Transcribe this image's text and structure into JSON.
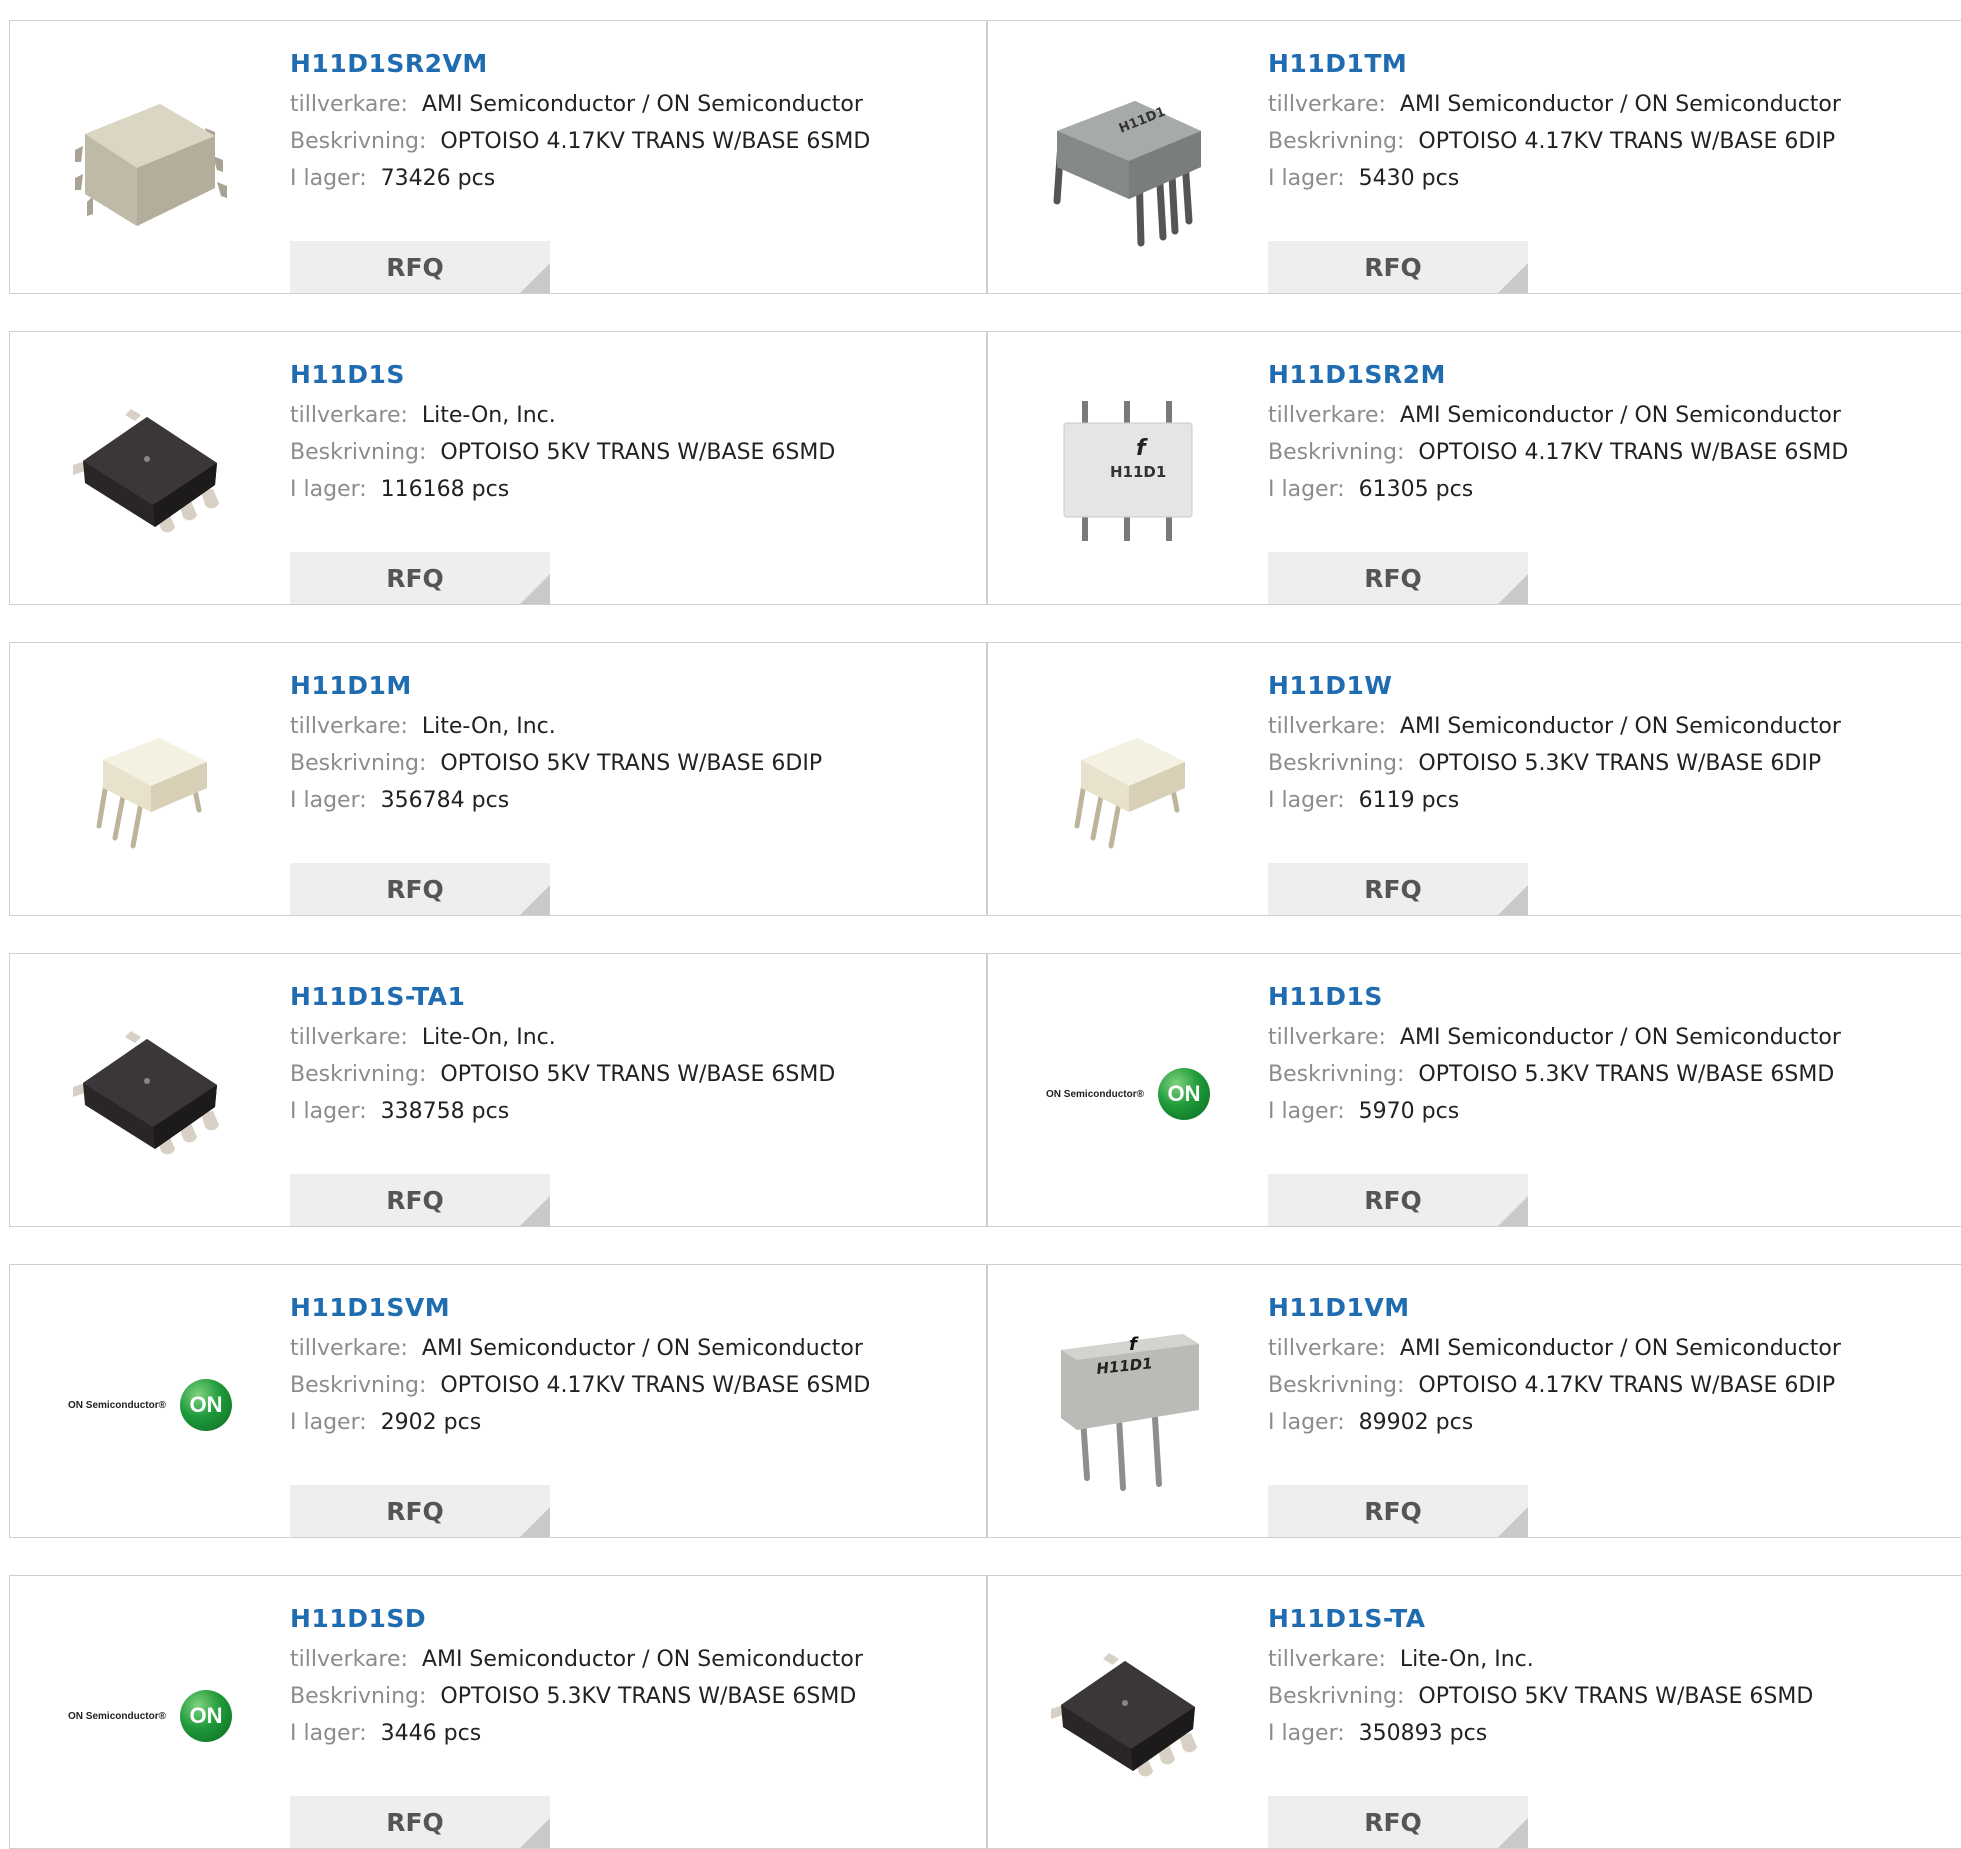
{
  "labels": {
    "manufacturer": "tillverkare:",
    "description": "Beskrivning:",
    "stock": "I lager:",
    "rfq": "RFQ"
  },
  "products": [
    {
      "name": "H11D1SR2VM",
      "manufacturer": "AMI Semiconductor / ON Semiconductor",
      "description": "OPTOISO 4.17KV TRANS W/BASE 6SMD",
      "stock": "73426 pcs",
      "image": "gray-smd-chip-icon"
    },
    {
      "name": "H11D1TM",
      "manufacturer": "AMI Semiconductor / ON Semiconductor",
      "description": "OPTOISO 4.17KV TRANS W/BASE 6DIP",
      "stock": "5430 pcs",
      "image": "gray-dip-chip-icon"
    },
    {
      "name": "H11D1S",
      "manufacturer": "Lite-On, Inc.",
      "description": "OPTOISO 5KV TRANS W/BASE 6SMD",
      "stock": "116168 pcs",
      "image": "black-smd-chip-icon"
    },
    {
      "name": "H11D1SR2M",
      "manufacturer": "AMI Semiconductor / ON Semiconductor",
      "description": "OPTOISO 4.17KV TRANS W/BASE 6SMD",
      "stock": "61305 pcs",
      "image": "white-chip-topview-icon",
      "chip_marking": "H11D1"
    },
    {
      "name": "H11D1M",
      "manufacturer": "Lite-On, Inc.",
      "description": "OPTOISO 5KV TRANS W/BASE 6DIP",
      "stock": "356784 pcs",
      "image": "cream-dip-chip-icon"
    },
    {
      "name": "H11D1W",
      "manufacturer": "AMI Semiconductor / ON Semiconductor",
      "description": "OPTOISO 5.3KV TRANS W/BASE 6DIP",
      "stock": "6119 pcs",
      "image": "cream-dip-chip-icon"
    },
    {
      "name": "H11D1S-TA1",
      "manufacturer": "Lite-On, Inc.",
      "description": "OPTOISO 5KV TRANS W/BASE 6SMD",
      "stock": "338758 pcs",
      "image": "black-smd-chip-icon"
    },
    {
      "name": "H11D1S",
      "manufacturer": "AMI Semiconductor / ON Semiconductor",
      "description": "OPTOISO 5.3KV TRANS W/BASE 6SMD",
      "stock": "5970 pcs",
      "image": "on-semiconductor-logo",
      "logo_text": "ON Semiconductor®",
      "logo_mark": "ON"
    },
    {
      "name": "H11D1SVM",
      "manufacturer": "AMI Semiconductor / ON Semiconductor",
      "description": "OPTOISO 4.17KV TRANS W/BASE 6SMD",
      "stock": "2902 pcs",
      "image": "on-semiconductor-logo",
      "logo_text": "ON Semiconductor®",
      "logo_mark": "ON"
    },
    {
      "name": "H11D1VM",
      "manufacturer": "AMI Semiconductor / ON Semiconductor",
      "description": "OPTOISO 4.17KV TRANS W/BASE 6DIP",
      "stock": "89902 pcs",
      "image": "gray-dip-chip-marked-icon",
      "chip_marking": "H11D1"
    },
    {
      "name": "H11D1SD",
      "manufacturer": "AMI Semiconductor / ON Semiconductor",
      "description": "OPTOISO 5.3KV TRANS W/BASE 6SMD",
      "stock": "3446 pcs",
      "image": "on-semiconductor-logo",
      "logo_text": "ON Semiconductor®",
      "logo_mark": "ON"
    },
    {
      "name": "H11D1S-TA",
      "manufacturer": "Lite-On, Inc.",
      "description": "OPTOISO 5KV TRANS W/BASE 6SMD",
      "stock": "350893 pcs",
      "image": "black-smd-chip-icon"
    }
  ]
}
